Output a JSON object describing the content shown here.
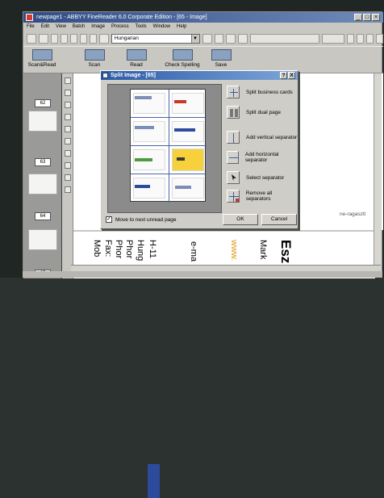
{
  "app": {
    "title": "newpage1 - ABBYY FineReader 6.0 Corporate Edition - [65 - Image]",
    "menus": [
      "File",
      "Edit",
      "View",
      "Batch",
      "Image",
      "Process",
      "Tools",
      "Window",
      "Help"
    ],
    "language": "Hungarian",
    "toolbar_buttons": [
      {
        "label": "Scan&Read",
        "icon": "scan-read-icon"
      },
      {
        "label": "Scan",
        "icon": "scanner-icon"
      },
      {
        "label": "Read",
        "icon": "read-icon"
      },
      {
        "label": "Check Spelling",
        "icon": "spellcheck-icon"
      },
      {
        "label": "Save",
        "icon": "save-icon"
      }
    ]
  },
  "thumbnails": [
    "62",
    "63",
    "64",
    "65"
  ],
  "document": {
    "visible_text": "ne-ragasztl",
    "ocr_lines": [
      "Mob",
      "Fax:",
      "Phor",
      "Phor",
      "Hung",
      "H-11",
      "e-ma",
      "www.",
      "Mark",
      "Esz"
    ]
  },
  "dialog": {
    "title": "Split Image - [65]",
    "title_buttons": [
      "?",
      "X"
    ],
    "actions": [
      "Split business cards",
      "Split dual page",
      "Add vertical separator",
      "Add horizontal separator",
      "Select separator",
      "Remove all separators"
    ],
    "checkbox_label": "Move to next unread page",
    "checkbox_checked": true,
    "ok_label": "OK",
    "cancel_label": "Cancel"
  }
}
